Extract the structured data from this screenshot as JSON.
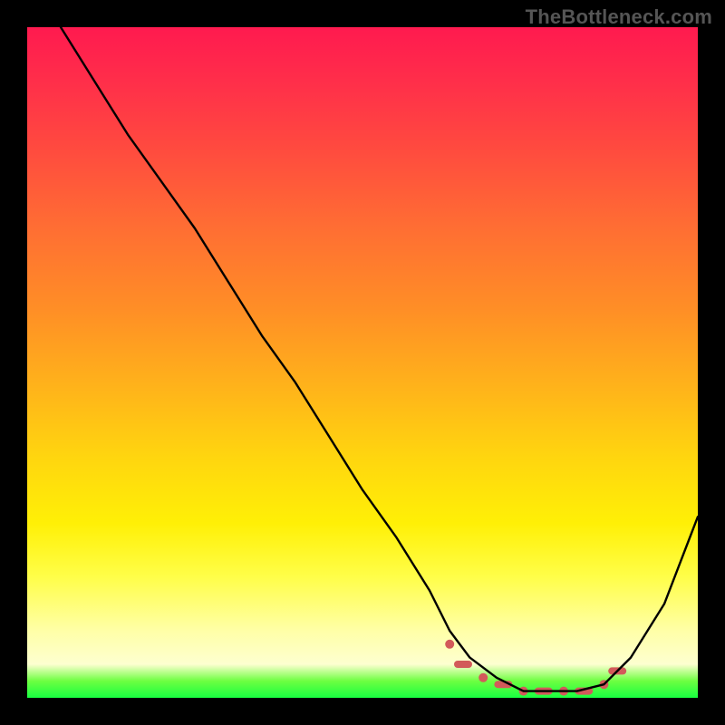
{
  "watermark": "TheBottleneck.com",
  "colors": {
    "background": "#000000",
    "watermark_text": "#555555",
    "curve_stroke": "#000000",
    "marker_fill": "#d25a5a",
    "gradient_stops": [
      {
        "pos": 0.0,
        "hex": "#ff1a4f"
      },
      {
        "pos": 0.18,
        "hex": "#ff4a3f"
      },
      {
        "pos": 0.42,
        "hex": "#ff8e26"
      },
      {
        "pos": 0.64,
        "hex": "#ffd50f"
      },
      {
        "pos": 0.82,
        "hex": "#fffe49"
      },
      {
        "pos": 0.95,
        "hex": "#fdffd0"
      },
      {
        "pos": 0.98,
        "hex": "#6dff41"
      },
      {
        "pos": 1.0,
        "hex": "#18ff41"
      }
    ]
  },
  "chart_data": {
    "type": "line",
    "title": "",
    "xlabel": "",
    "ylabel": "",
    "xlim": [
      0,
      100
    ],
    "ylim": [
      0,
      100
    ],
    "note": "No axis ticks or numeric labels are rendered in the image; x/y values are normalized 0–100 estimated from pixel position. y≈0 corresponds to the green strip at the bottom (optimal / no bottleneck), y≈100 to the red top (severe bottleneck).",
    "series": [
      {
        "name": "bottleneck-curve",
        "x": [
          5,
          10,
          15,
          20,
          25,
          30,
          35,
          40,
          45,
          50,
          55,
          60,
          63,
          66,
          70,
          74,
          78,
          82,
          86,
          90,
          95,
          100
        ],
        "y": [
          100,
          92,
          84,
          77,
          70,
          62,
          54,
          47,
          39,
          31,
          24,
          16,
          10,
          6,
          3,
          1,
          1,
          1,
          2,
          6,
          14,
          27
        ]
      }
    ],
    "markers": {
      "name": "highlighted-range",
      "x": [
        63,
        65,
        68,
        71,
        74,
        77,
        80,
        83,
        86,
        88
      ],
      "y": [
        8,
        5,
        3,
        2,
        1,
        1,
        1,
        1,
        2,
        4
      ]
    }
  }
}
